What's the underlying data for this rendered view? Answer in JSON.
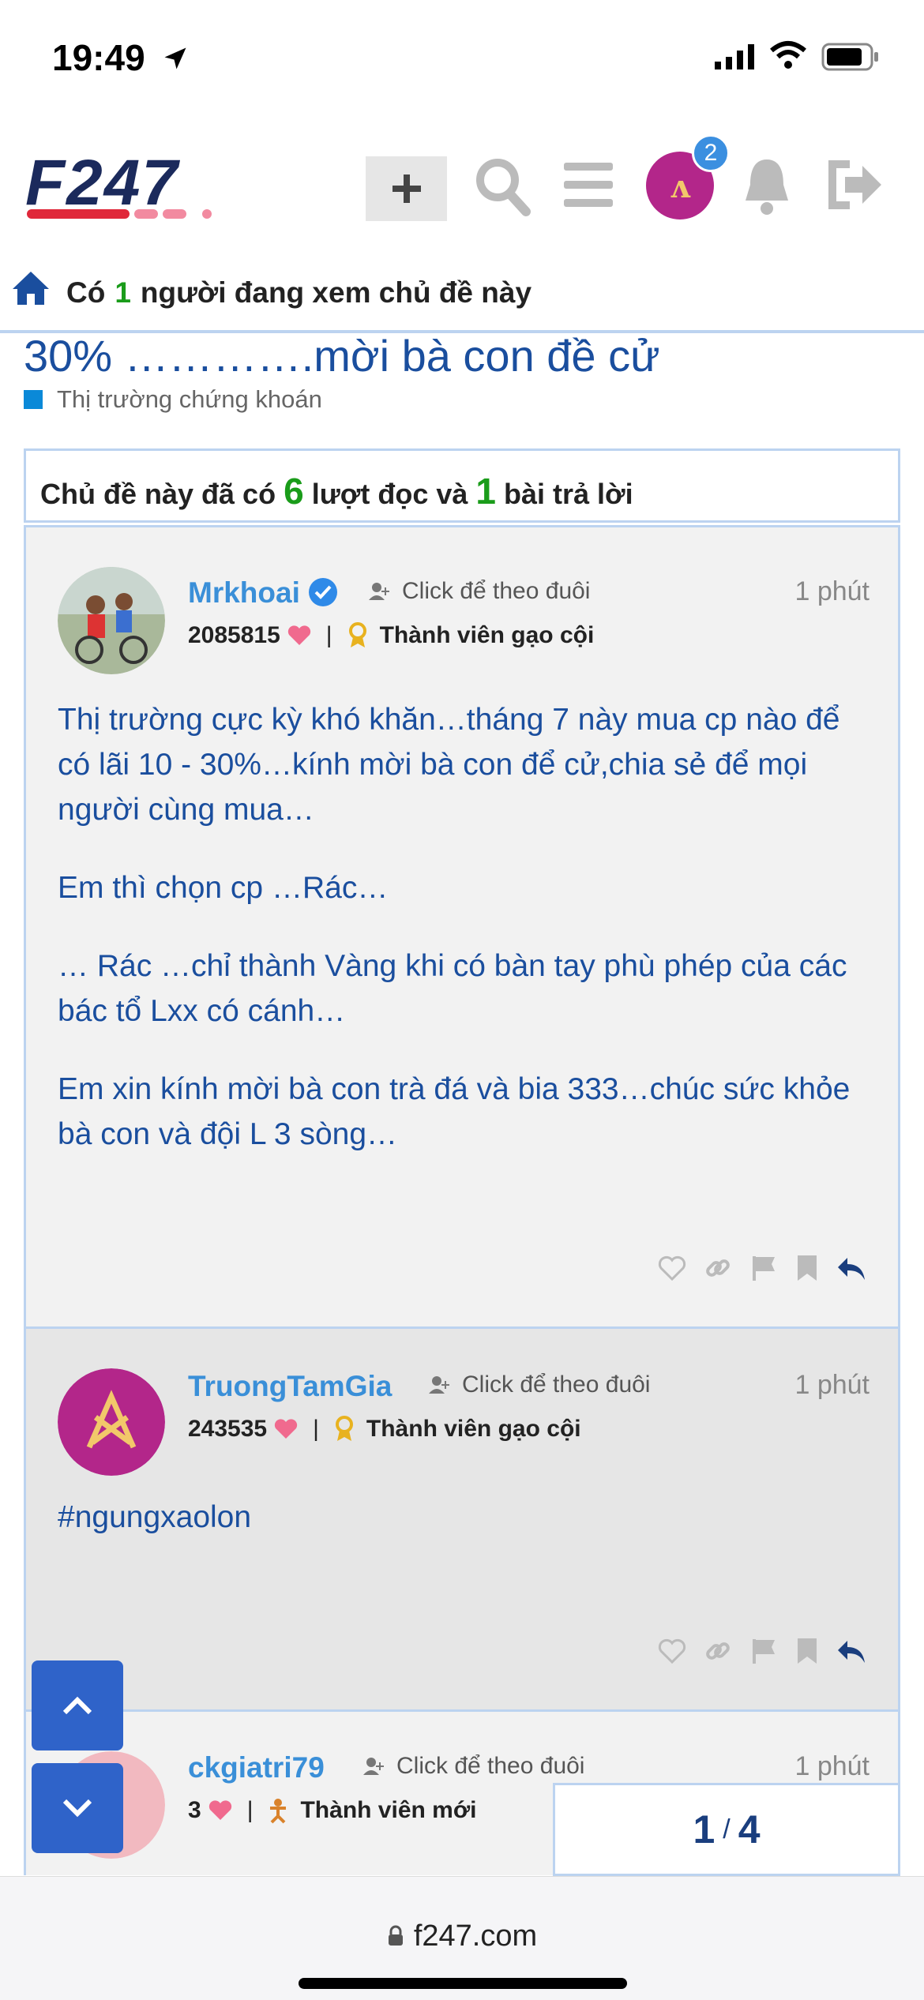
{
  "status_bar": {
    "time": "19:49"
  },
  "header": {
    "logo_text": "F247",
    "notification_count": "2"
  },
  "viewers": {
    "prefix": "Có",
    "count": "1",
    "suffix": "người đang xem chủ đề này"
  },
  "topic": {
    "title": "30% ………….mời bà con đề cử",
    "category": "Thị trường chứng khoán",
    "category_color": "#0a89d8"
  },
  "stats": {
    "prefix": "Chủ đề này đã có",
    "views": "6",
    "middle": "lượt đọc và",
    "replies": "1",
    "suffix": "bài trả lời"
  },
  "posts": [
    {
      "username": "Mrkhoai",
      "follow": "Click để theo đuôi",
      "time": "1 phút",
      "score": "2085815",
      "rank": "Thành viên gạo cội",
      "paragraphs": [
        "Thị trường cực kỳ khó khăn…tháng 7 này mua cp nào để có lãi 10 - 30%…kính mời bà con để cử,chia sẻ để mọi người cùng mua…",
        "Em thì chọn cp …Rác…",
        "… Rác …chỉ thành Vàng khi có bàn tay phù phép của các bác tổ Lxx có cánh…",
        "Em xin kính mời bà con trà đá và bia 333…chúc sức khỏe bà con và đội L 3 sòng…"
      ]
    },
    {
      "username": "TruongTamGia",
      "follow": "Click để theo đuôi",
      "time": "1 phút",
      "score": "243535",
      "rank": "Thành viên gạo cội",
      "paragraphs": [
        "#ngungxaolon"
      ]
    },
    {
      "username": "ckgiatri79",
      "follow": "Click để theo đuôi",
      "time": "1 phút",
      "score": "3",
      "rank": "Thành viên mới",
      "paragraphs": []
    }
  ],
  "pager": {
    "current": "1",
    "total": "4"
  },
  "browser": {
    "url": "f247.com"
  },
  "colors": {
    "link_blue": "#1a4e9e",
    "username_blue": "#3a8fd8",
    "accent_green": "#1a9c1a",
    "scroll_button": "#2f63c9"
  }
}
